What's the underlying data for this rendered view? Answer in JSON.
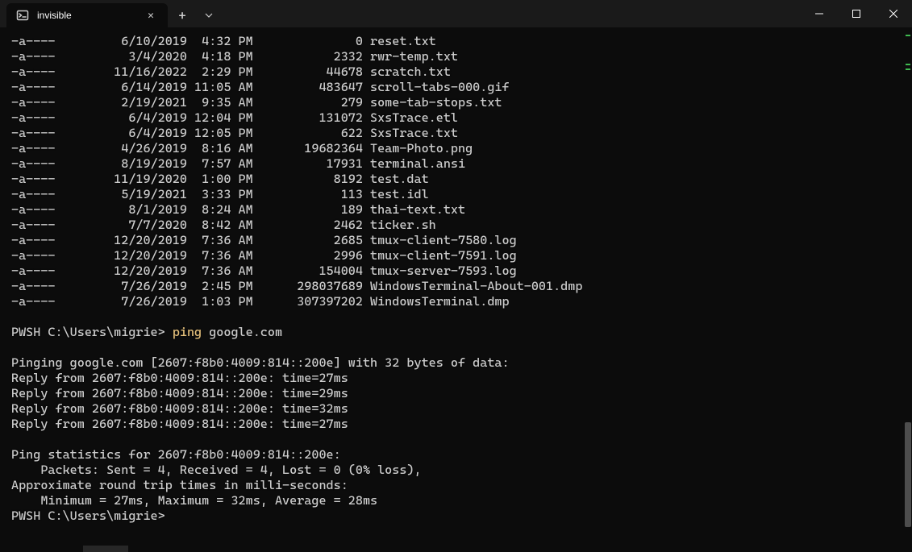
{
  "tab": {
    "title": "invisible"
  },
  "files": [
    {
      "mode": "-a----",
      "date": "6/10/2019",
      "time": "4:32 PM",
      "size": "0",
      "name": "reset.txt"
    },
    {
      "mode": "-a----",
      "date": "3/4/2020",
      "time": "4:18 PM",
      "size": "2332",
      "name": "rwr-temp.txt"
    },
    {
      "mode": "-a----",
      "date": "11/16/2022",
      "time": "2:29 PM",
      "size": "44678",
      "name": "scratch.txt"
    },
    {
      "mode": "-a----",
      "date": "6/14/2019",
      "time": "11:05 AM",
      "size": "483647",
      "name": "scroll-tabs-000.gif"
    },
    {
      "mode": "-a----",
      "date": "2/19/2021",
      "time": "9:35 AM",
      "size": "279",
      "name": "some-tab-stops.txt"
    },
    {
      "mode": "-a----",
      "date": "6/4/2019",
      "time": "12:04 PM",
      "size": "131072",
      "name": "SxsTrace.etl"
    },
    {
      "mode": "-a----",
      "date": "6/4/2019",
      "time": "12:05 PM",
      "size": "622",
      "name": "SxsTrace.txt"
    },
    {
      "mode": "-a----",
      "date": "4/26/2019",
      "time": "8:16 AM",
      "size": "19682364",
      "name": "Team-Photo.png"
    },
    {
      "mode": "-a----",
      "date": "8/19/2019",
      "time": "7:57 AM",
      "size": "17931",
      "name": "terminal.ansi"
    },
    {
      "mode": "-a----",
      "date": "11/19/2020",
      "time": "1:00 PM",
      "size": "8192",
      "name": "test.dat"
    },
    {
      "mode": "-a----",
      "date": "5/19/2021",
      "time": "3:33 PM",
      "size": "113",
      "name": "test.idl"
    },
    {
      "mode": "-a----",
      "date": "8/1/2019",
      "time": "8:24 AM",
      "size": "189",
      "name": "thai-text.txt"
    },
    {
      "mode": "-a----",
      "date": "7/7/2020",
      "time": "8:42 AM",
      "size": "2462",
      "name": "ticker.sh"
    },
    {
      "mode": "-a----",
      "date": "12/20/2019",
      "time": "7:36 AM",
      "size": "2685",
      "name": "tmux-client-7580.log"
    },
    {
      "mode": "-a----",
      "date": "12/20/2019",
      "time": "7:36 AM",
      "size": "2996",
      "name": "tmux-client-7591.log"
    },
    {
      "mode": "-a----",
      "date": "12/20/2019",
      "time": "7:36 AM",
      "size": "154004",
      "name": "tmux-server-7593.log"
    },
    {
      "mode": "-a----",
      "date": "7/26/2019",
      "time": "2:45 PM",
      "size": "298037689",
      "name": "WindowsTerminal-About-001.dmp"
    },
    {
      "mode": "-a----",
      "date": "7/26/2019",
      "time": "1:03 PM",
      "size": "307397202",
      "name": "WindowsTerminal.dmp"
    }
  ],
  "prompt1": {
    "prefix": "PWSH C:\\Users\\migrie> ",
    "cmd": "ping",
    "args": " google.com"
  },
  "ping_output": [
    "",
    "Pinging google.com [2607:f8b0:4009:814::200e] with 32 bytes of data:",
    "Reply from 2607:f8b0:4009:814::200e: time=27ms",
    "Reply from 2607:f8b0:4009:814::200e: time=29ms",
    "Reply from 2607:f8b0:4009:814::200e: time=32ms",
    "Reply from 2607:f8b0:4009:814::200e: time=27ms",
    "",
    "Ping statistics for 2607:f8b0:4009:814::200e:",
    "    Packets: Sent = 4, Received = 4, Lost = 0 (0% loss),",
    "Approximate round trip times in milli-seconds:",
    "    Minimum = 27ms, Maximum = 32ms, Average = 28ms"
  ],
  "prompt2": "PWSH C:\\Users\\migrie>",
  "marks": [
    9,
    45,
    51,
    566
  ]
}
